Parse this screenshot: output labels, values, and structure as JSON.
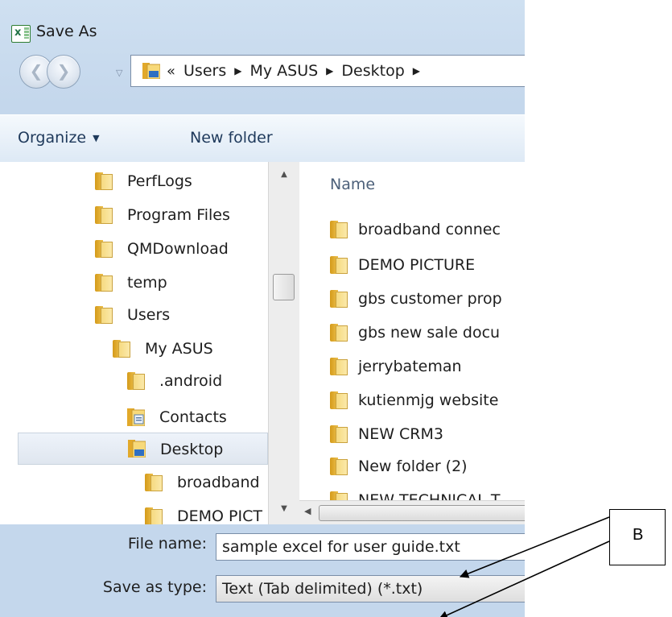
{
  "window": {
    "title": "Save As",
    "app_icon": "excel-icon"
  },
  "nav": {
    "back_icon": "back-arrow-icon",
    "forward_icon": "forward-arrow-icon",
    "recent_icon": "chevron-down-icon"
  },
  "address": {
    "overflow": "«",
    "crumbs": [
      "Users",
      "My ASUS",
      "Desktop"
    ],
    "separator": "▶"
  },
  "toolbar": {
    "organize_label": "Organize",
    "new_folder_label": "New folder"
  },
  "sidebar": {
    "items": [
      {
        "label": "PerfLogs",
        "icon": "folder-icon"
      },
      {
        "label": "Program Files",
        "icon": "folder-icon"
      },
      {
        "label": "QMDownload",
        "icon": "folder-icon"
      },
      {
        "label": "temp",
        "icon": "folder-icon"
      },
      {
        "label": "Users",
        "icon": "folder-icon"
      },
      {
        "label": "My ASUS",
        "icon": "user-folder-icon"
      },
      {
        "label": ".android",
        "icon": "folder-icon"
      },
      {
        "label": "Contacts",
        "icon": "contacts-folder-icon"
      },
      {
        "label": "Desktop",
        "icon": "desktop-folder-icon",
        "selected": true
      },
      {
        "label": "broadband",
        "icon": "folder-icon"
      },
      {
        "label": "DEMO PICT",
        "icon": "folder-icon"
      }
    ]
  },
  "files": {
    "column_header": "Name",
    "items": [
      "broadband connec",
      "DEMO PICTURE",
      "gbs customer prop",
      "gbs new sale docu",
      "jerrybateman",
      "kutienmjg website",
      "NEW CRM3",
      "New folder (2)",
      "NEW TECHNICAL T"
    ]
  },
  "form": {
    "file_name_label": "File name:",
    "file_name_value": "sample excel for user guide.txt",
    "save_type_label": "Save as type:",
    "save_type_value": "Text (Tab delimited) (*.txt)"
  },
  "annotation": {
    "callout_label": "B"
  }
}
